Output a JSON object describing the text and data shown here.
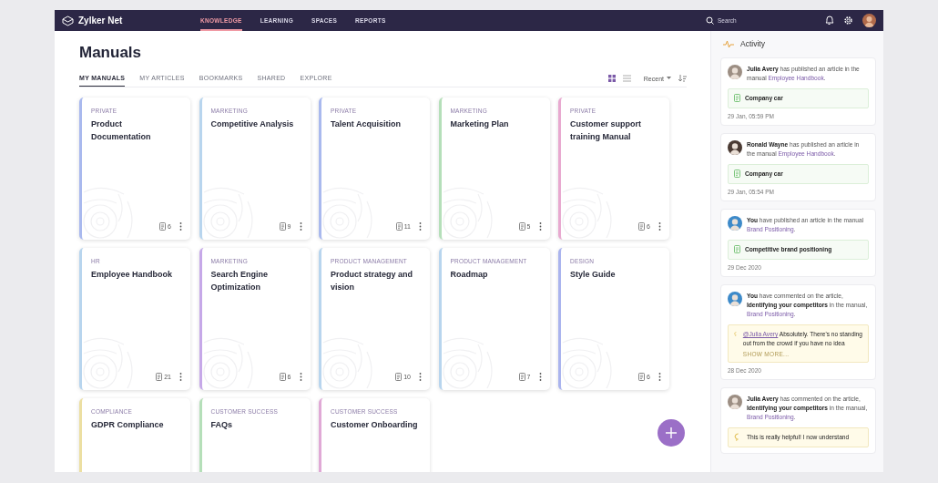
{
  "nav": {
    "brand": "Zylker Net",
    "items": [
      {
        "label": "KNOWLEDGE",
        "selected": true
      },
      {
        "label": "LEARNING",
        "selected": false
      },
      {
        "label": "SPACES",
        "selected": false
      },
      {
        "label": "REPORTS",
        "selected": false
      }
    ],
    "search": {
      "placeholder": "Search"
    }
  },
  "page": {
    "title": "Manuals",
    "tabs": [
      {
        "label": "MY MANUALS",
        "selected": true
      },
      {
        "label": "MY ARTICLES",
        "selected": false
      },
      {
        "label": "BOOKMARKS",
        "selected": false
      },
      {
        "label": "SHARED",
        "selected": false
      },
      {
        "label": "EXPLORE",
        "selected": false
      }
    ],
    "views": [
      {
        "kind": "grid",
        "selected": true
      },
      {
        "kind": "list",
        "selected": false
      }
    ],
    "sort": "Recent"
  },
  "manuals": [
    {
      "category": "PRIVATE",
      "title": "Product Documentation",
      "count": "6",
      "color": "#a9b9ee"
    },
    {
      "category": "MARKETING",
      "title": "Competitive Analysis",
      "count": "9",
      "color": "#b8d5ee"
    },
    {
      "category": "PRIVATE",
      "title": "Talent Acquisition",
      "count": "11",
      "color": "#a9b9ee"
    },
    {
      "category": "MARKETING",
      "title": "Marketing Plan",
      "count": "5",
      "color": "#b5dfb9"
    },
    {
      "category": "PRIVATE",
      "title": "Customer support training Manual",
      "count": "6",
      "color": "#e8a9d0"
    },
    {
      "category": "HR",
      "title": "Employee Handbook",
      "count": "21",
      "color": "#b8d5ee"
    },
    {
      "category": "MARKETING",
      "title": "Search Engine Optimization",
      "count": "6",
      "color": "#c6a8e8"
    },
    {
      "category": "PRODUCT MANAGEMENT",
      "title": "Product strategy and vision",
      "count": "10",
      "color": "#b8d5ee"
    },
    {
      "category": "PRODUCT MANAGEMENT",
      "title": "Roadmap",
      "count": "7",
      "color": "#b8d5ee"
    },
    {
      "category": "DESIGN",
      "title": "Style Guide",
      "count": "6",
      "color": "#aab4ee"
    },
    {
      "category": "COMPLIANCE",
      "title": "GDPR Compliance",
      "color": "#ecdfa2"
    },
    {
      "category": "CUSTOMER SUCCESS",
      "title": "FAQs",
      "color": "#b5dfb9"
    },
    {
      "category": "CUSTOMER SUCCESS",
      "title": "Customer Onboarding",
      "color": "#e0a9d6"
    }
  ],
  "activity": {
    "title": "Activity",
    "items": [
      {
        "color": "#9c8e83",
        "text": "**Julia Avery** has published an article in the manual ",
        "link": "Employee Handbook",
        "tail": ".",
        "attachment": {
          "kind": "article",
          "title": "Company car"
        },
        "date": "29 Jan, 05:59 PM"
      },
      {
        "color": "#4a3a33",
        "text": "**Ronald Wayne** has published an article in the manual ",
        "link": "Employee Handbook",
        "tail": ".",
        "attachment": {
          "kind": "article",
          "title": "Company car"
        },
        "date": "29 Jan, 05:54 PM"
      },
      {
        "color": "#3d8ac9",
        "text": "**You** have published an article in the manual ",
        "link": "Brand Positioning",
        "tail": ".",
        "attachment": {
          "kind": "article",
          "title": "Competitive brand positioning"
        },
        "date": "29 Dec 2020"
      },
      {
        "color": "#3d8ac9",
        "text": "**You** have commented on the article, **Identifying your competitors** in the manual, ",
        "link": "Brand Positioning",
        "tail": ".",
        "attachment": {
          "kind": "comment",
          "mention": "@Julia Avery",
          "title": " Absolutely. There's no standing out from the crowd if you have no idea",
          "more": "SHOW MORE..."
        },
        "date": "28 Dec 2020"
      },
      {
        "color": "#9c8e83",
        "text": "**Julia Avery** has commented on the article, **Identifying your competitors** in the manual, ",
        "link": "Brand Positioning",
        "tail": ".",
        "attachment": {
          "kind": "comment",
          "title": "This is really helpful! I now understand"
        }
      }
    ]
  }
}
